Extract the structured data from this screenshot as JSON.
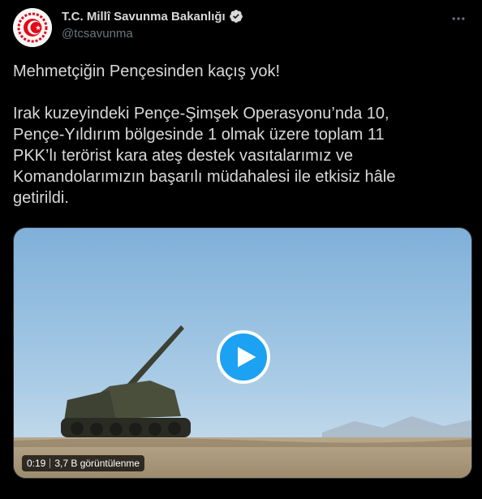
{
  "author": {
    "display_name": "T.C. Millî Savunma Bakanlığı",
    "handle": "@tcsavunma",
    "verified": true,
    "avatar_icon": "ministry-emblem-icon"
  },
  "tweet": {
    "line1": "Mehmetçiğin Pençesinden kaçış yok!",
    "body_lines": [
      "Irak kuzeyindeki Pençe-Şimşek Operasyonu’nda 10,",
      "Pençe-Yıldırım bölgesinde 1 olmak üzere toplam 11",
      "PKK’lı terörist kara ateş destek vasıtalarımız ve",
      "Komandolarımızın başarılı müdahalesi ile etkisiz hâle",
      "getirildi."
    ]
  },
  "video": {
    "duration": "0:19",
    "views": "3,7 B görüntülenme",
    "play_icon": "play-icon"
  },
  "colors": {
    "background": "#000000",
    "text": "#d9d9d9",
    "muted": "#6e767d",
    "accent": "#1da1f2",
    "emblem_red": "#e30a17"
  }
}
